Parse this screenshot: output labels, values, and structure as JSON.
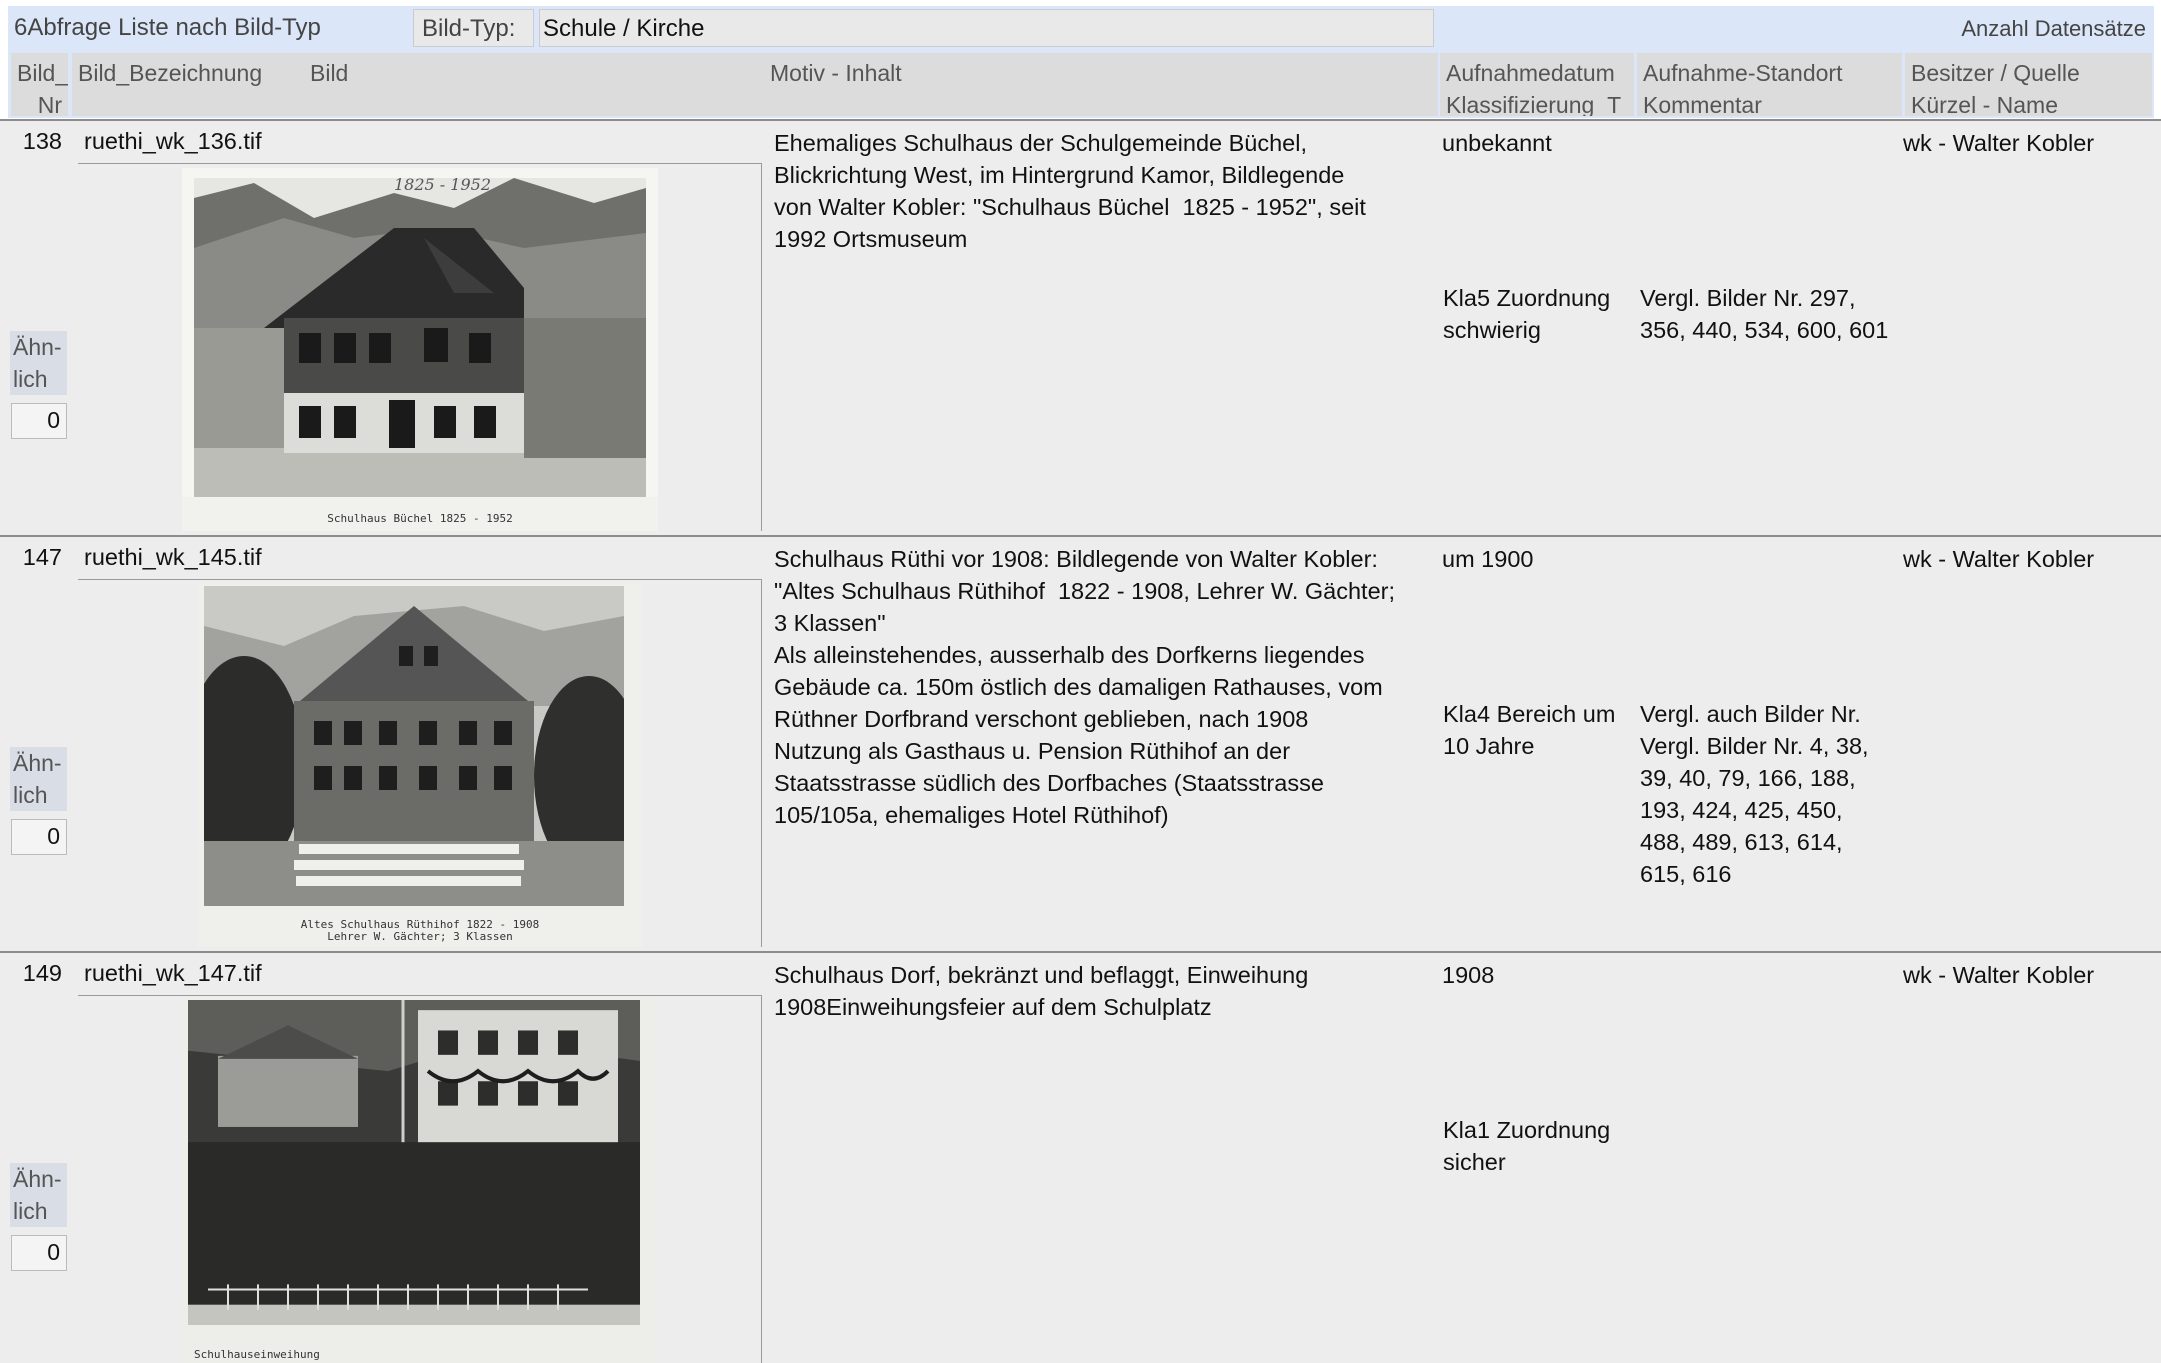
{
  "header": {
    "report_title": "6Abfrage Liste nach Bild-Typ",
    "filter_label": "Bild-Typ:",
    "filter_value": "Schule / Kirche",
    "count_label": "Anzahl Datensätze"
  },
  "columns": {
    "nr_line1": "Bild_",
    "nr_line2": "Nr",
    "bezeichnung": "Bild_Bezeichnung",
    "bild": "Bild",
    "motiv": "Motiv - Inhalt",
    "datum_line1": "Aufnahmedatum",
    "datum_line2": "Klassifizierung_T",
    "standort_line1": "Aufnahme-Standort",
    "standort_line2": "Kommentar",
    "besitzer_line1": "Besitzer / Quelle",
    "besitzer_line2": "Kürzel - Name"
  },
  "records": [
    {
      "nr": "138",
      "file": "ruethi_wk_136.tif",
      "motiv": "Ehemaliges Schulhaus der Schulgemeinde Büchel,\nBlickrichtung West, im Hintergrund Kamor, Bildlegende\nvon Walter Kobler: \"Schulhaus Büchel  1825 - 1952\", seit\n1992 Ortsmuseum",
      "datum": "unbekannt",
      "besitzer": "wk - Walter Kobler",
      "klass": "Kla5 Zuordnung schwierig",
      "kommentar": "Vergl. Bilder Nr. 297, 356, 440, 534, 600, 601",
      "photo_caption": "Schulhaus Büchel 1825 - 1952",
      "photo_scrawl": "1825 - 1952",
      "aehnlich_label": "Ähn-lich",
      "aehnlich_value": "0"
    },
    {
      "nr": "147",
      "file": "ruethi_wk_145.tif",
      "motiv": "Schulhaus Rüthi vor 1908: Bildlegende von Walter Kobler:\n\"Altes Schulhaus Rüthihof  1822 - 1908, Lehrer W. Gächter;\n3 Klassen\"\nAls alleinstehendes, ausserhalb des Dorfkerns liegendes\nGebäude ca. 150m östlich des damaligen Rathauses, vom\nRüthner Dorfbrand verschont geblieben, nach 1908\nNutzung als Gasthaus u. Pension Rüthihof an der\nStaatsstrasse südlich des Dorfbaches (Staatsstrasse\n105/105a, ehemaliges Hotel Rüthihof)",
      "datum": "um 1900",
      "besitzer": "wk - Walter Kobler",
      "klass": "Kla4 Bereich um 10 Jahre",
      "kommentar": "Vergl. auch Bilder Nr. Vergl. Bilder Nr. 4, 38, 39, 40, 79, 166, 188, 193, 424, 425, 450, 488, 489, 613, 614, 615, 616",
      "photo_caption": "Altes Schulhaus Rüthihof 1822 - 1908\nLehrer W. Gächter; 3 Klassen",
      "aehnlich_label": "Ähn-lich",
      "aehnlich_value": "0"
    },
    {
      "nr": "149",
      "file": "ruethi_wk_147.tif",
      "motiv": "Schulhaus Dorf, bekränzt und beflaggt, Einweihung\n1908Einweihungsfeier auf dem Schulplatz",
      "datum": "1908",
      "besitzer": "wk - Walter Kobler",
      "klass": "Kla1 Zuordnung sicher",
      "kommentar": "",
      "photo_caption": "Schulhauseinweihung",
      "aehnlich_label": "Ähn-lich",
      "aehnlich_value": "0"
    }
  ]
}
